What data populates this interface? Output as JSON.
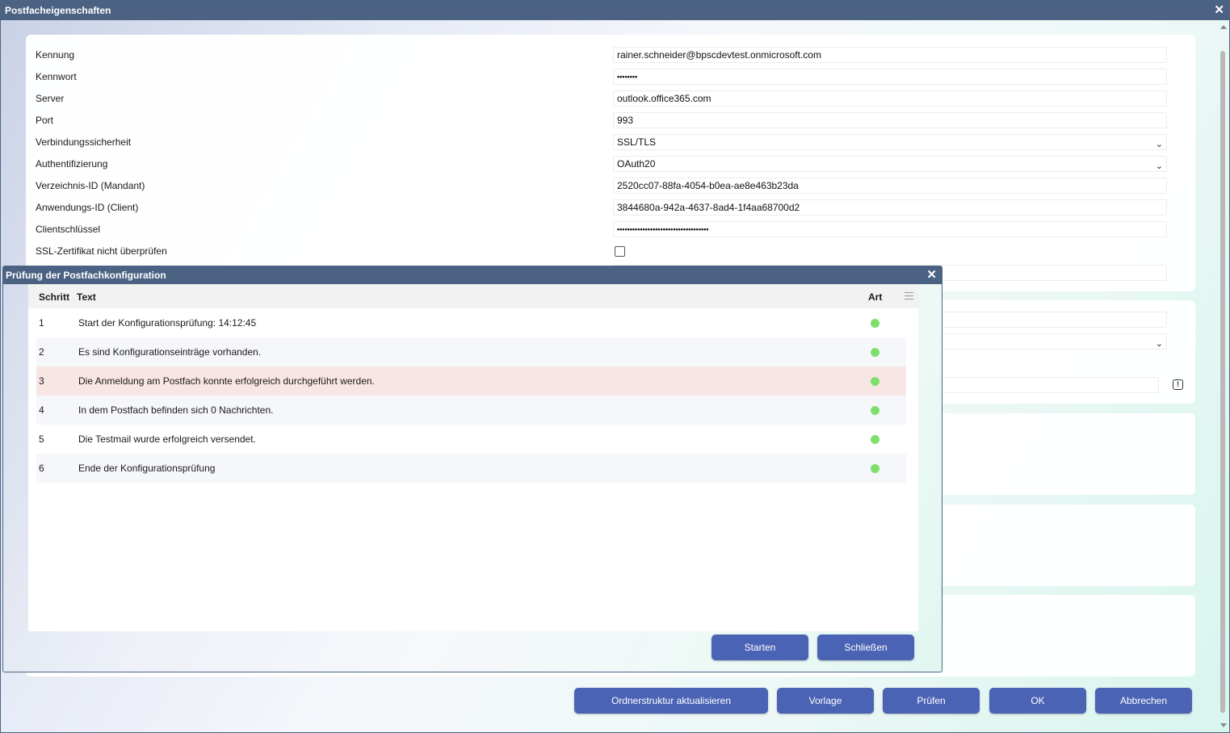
{
  "window": {
    "title": "Postfacheigenschaften",
    "close_glyph": "✕"
  },
  "form": {
    "rows": [
      {
        "label": "Kennung",
        "value": "rainer.schneider@bpscdevtest.onmicrosoft.com"
      },
      {
        "label": "Kennwort",
        "value": "••••••••"
      },
      {
        "label": "Server",
        "value": "outlook.office365.com"
      },
      {
        "label": "Port",
        "value": "993"
      },
      {
        "label": "Verbindungssicherheit",
        "value": "SSL/TLS"
      },
      {
        "label": "Authentifizierung",
        "value": "OAuth20"
      },
      {
        "label": "Verzeichnis-ID (Mandant)",
        "value": "2520cc07-88fa-4054-b0ea-ae8e463b23da"
      },
      {
        "label": "Anwendungs-ID (Client)",
        "value": "3844680a-942a-4637-8ad4-1f4aa68700d2"
      },
      {
        "label": "Clientschlüssel",
        "value": "••••••••••••••••••••••••••••••••••••"
      },
      {
        "label": "SSL-Zertifikat nicht überprüfen",
        "checked": false
      }
    ],
    "dropdown_caret": "⌄",
    "info_icon": "!"
  },
  "footer": {
    "refresh_label": "Ordnerstruktur aktualisieren",
    "template_label": "Vorlage",
    "check_label": "Prüfen",
    "ok_label": "OK",
    "cancel_label": "Abbrechen"
  },
  "dialog": {
    "title": "Prüfung der Postfachkonfiguration",
    "close_glyph": "✕",
    "columns": {
      "step": "Schritt",
      "text": "Text",
      "type": "Art"
    },
    "rows": [
      {
        "step": "1",
        "text": "Start der Konfigurationsprüfung: 14:12:45",
        "status": "ok"
      },
      {
        "step": "2",
        "text": "Es sind Konfigurationseinträge vorhanden.",
        "status": "ok"
      },
      {
        "step": "3",
        "text": "Die Anmeldung am Postfach konnte erfolgreich durchgeführt werden.",
        "status": "ok"
      },
      {
        "step": "4",
        "text": "In dem Postfach befinden sich 0 Nachrichten.",
        "status": "ok"
      },
      {
        "step": "5",
        "text": "Die Testmail wurde erfolgreich versendet.",
        "status": "ok"
      },
      {
        "step": "6",
        "text": "Ende der Konfigurationsprüfung",
        "status": "ok"
      }
    ],
    "start_label": "Starten",
    "close_label": "Schließen"
  },
  "colors": {
    "titlebar": "#4b6283",
    "button": "#4b63b5",
    "status_ok": "#7ee06a",
    "selected_row": "#f8e6e4"
  }
}
